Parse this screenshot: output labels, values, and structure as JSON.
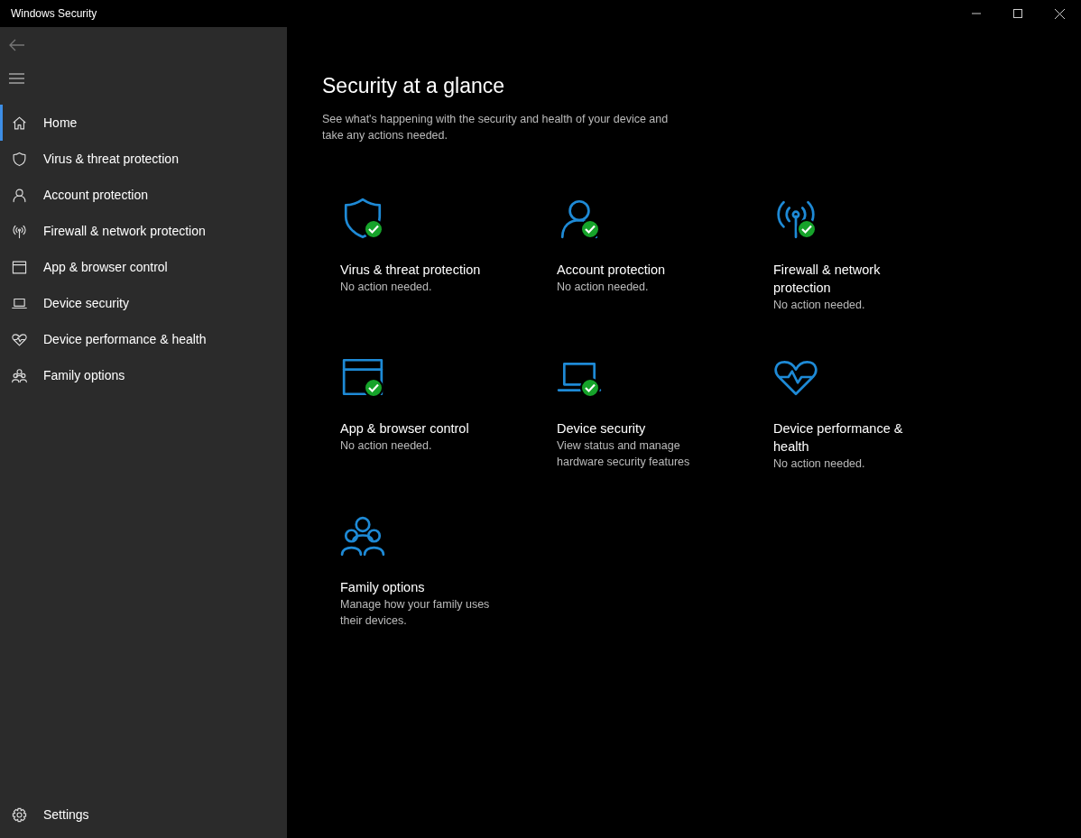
{
  "window": {
    "title": "Windows Security"
  },
  "sidebar": {
    "items": [
      {
        "label": "Home",
        "selected": true
      },
      {
        "label": "Virus & threat protection",
        "selected": false
      },
      {
        "label": "Account protection",
        "selected": false
      },
      {
        "label": "Firewall & network protection",
        "selected": false
      },
      {
        "label": "App & browser control",
        "selected": false
      },
      {
        "label": "Device security",
        "selected": false
      },
      {
        "label": "Device performance & health",
        "selected": false
      },
      {
        "label": "Family options",
        "selected": false
      }
    ],
    "settings": "Settings"
  },
  "main": {
    "title": "Security at a glance",
    "subtitle": "See what's happening with the security and health of your device and take any actions needed.",
    "cards": [
      {
        "title": "Virus & threat protection",
        "status": "No action needed.",
        "ok": true
      },
      {
        "title": "Account protection",
        "status": "No action needed.",
        "ok": true
      },
      {
        "title": "Firewall & network protection",
        "status": "No action needed.",
        "ok": true
      },
      {
        "title": "App & browser control",
        "status": "No action needed.",
        "ok": true
      },
      {
        "title": "Device security",
        "status": "View status and manage hardware security features",
        "ok": true
      },
      {
        "title": "Device performance & health",
        "status": "No action needed.",
        "ok": false
      },
      {
        "title": "Family options",
        "status": "Manage how your family uses their devices.",
        "ok": false
      }
    ]
  }
}
